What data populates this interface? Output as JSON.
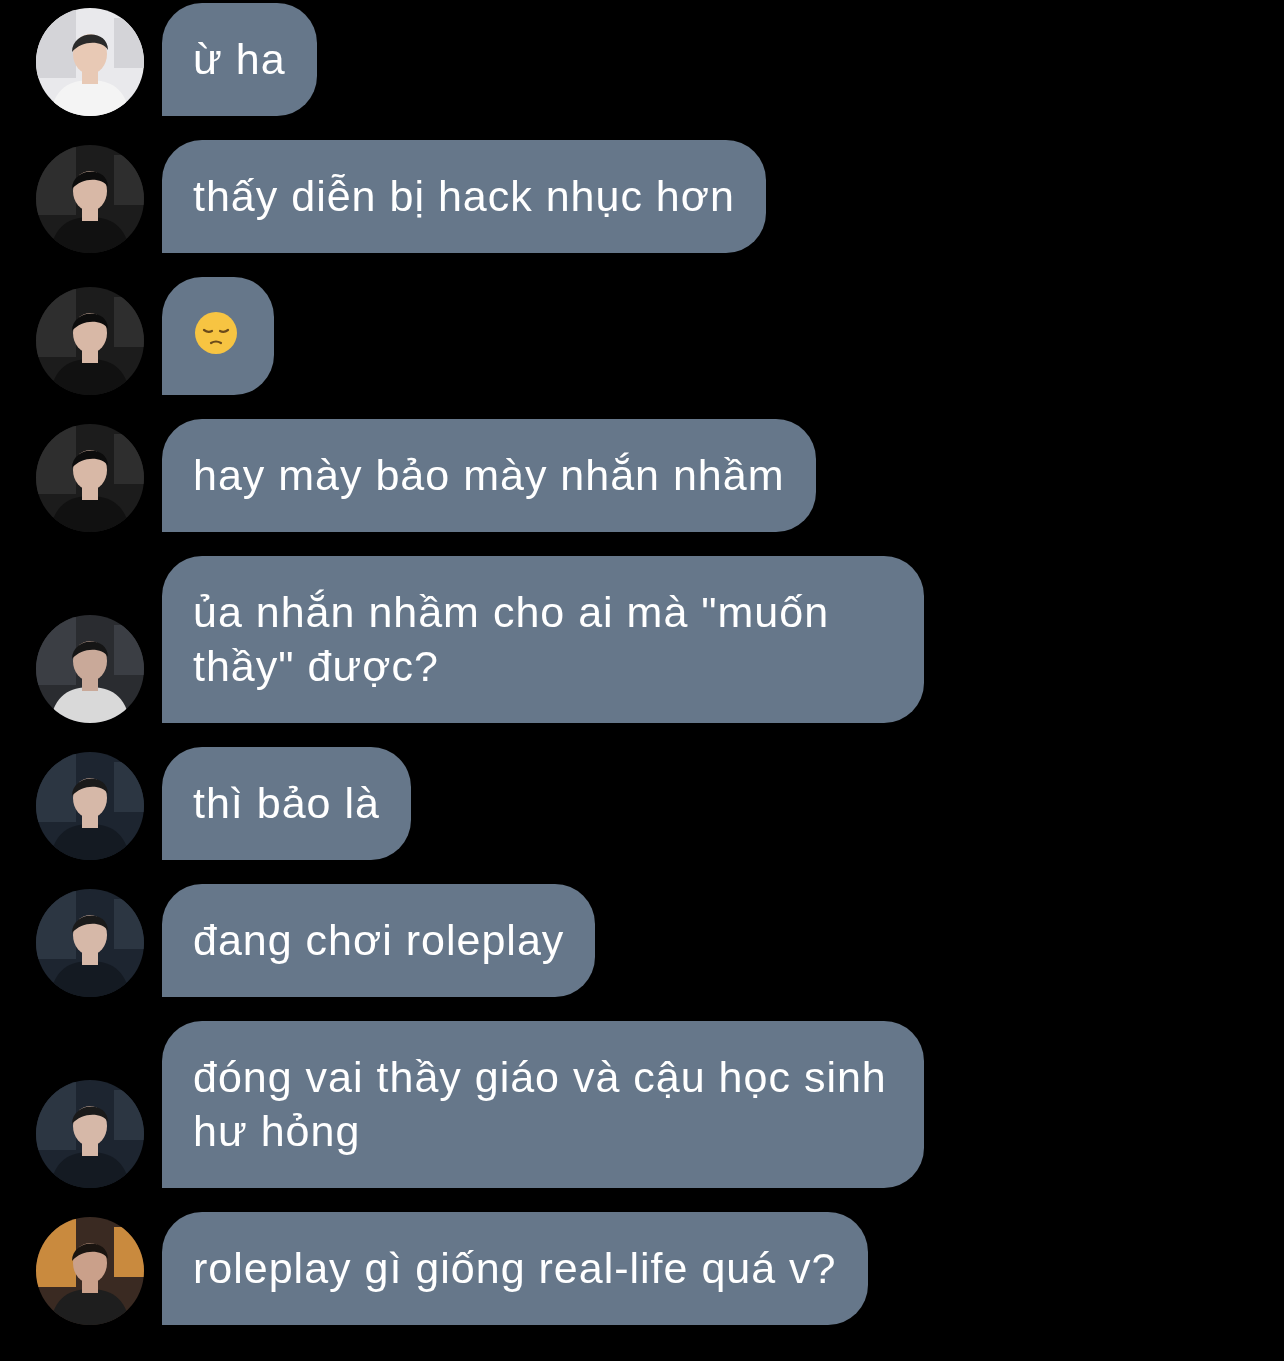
{
  "messages": [
    {
      "kind": "text",
      "text": "ừ ha"
    },
    {
      "kind": "text",
      "text": "thấy diễn bị hack nhục hơn"
    },
    {
      "kind": "emoji"
    },
    {
      "kind": "text",
      "text": "hay mày bảo mày nhắn nhầm"
    },
    {
      "kind": "text",
      "text": "ủa nhắn nhầm cho ai mà \"muốn thầy\" được?"
    },
    {
      "kind": "text",
      "text": "thì bảo là"
    },
    {
      "kind": "text",
      "text": "đang chơi roleplay"
    },
    {
      "kind": "text",
      "text": "đóng vai thầy giáo và cậu học sinh hư hỏng"
    },
    {
      "kind": "text",
      "text": "roleplay gì giống real-life quá v?"
    }
  ]
}
